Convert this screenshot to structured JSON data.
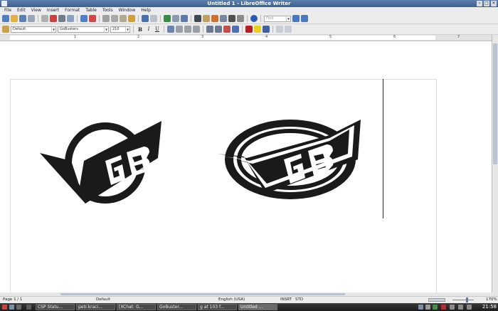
{
  "window": {
    "title": "Untitled 1 - LibreOffice Writer"
  },
  "menu": [
    "File",
    "Edit",
    "View",
    "Insert",
    "Format",
    "Table",
    "Tools",
    "Window",
    "Help"
  ],
  "toolbar": {
    "find_placeholder": "Find"
  },
  "formatting": {
    "style": "Default",
    "font": "GoBusters",
    "size": "210"
  },
  "ruler": {
    "marks": [
      "1",
      "2",
      "3",
      "4",
      "5",
      "6",
      "7"
    ]
  },
  "statusbar": {
    "page": "Page 1 / 1",
    "style": "Default",
    "language": "English (USA)",
    "mode": "INSRT",
    "selection": "STD",
    "zoom": "170%"
  },
  "taskbar": {
    "tasks": [
      "CSP Statu...",
      "petr.kraci...",
      "[XChat: G...",
      "GoBuster...",
      "g at 103 f...",
      "Untitled ..."
    ],
    "clock": "21:58"
  },
  "colors": {
    "accent": "#3d5f8e",
    "ink": "#1a1a1a"
  }
}
